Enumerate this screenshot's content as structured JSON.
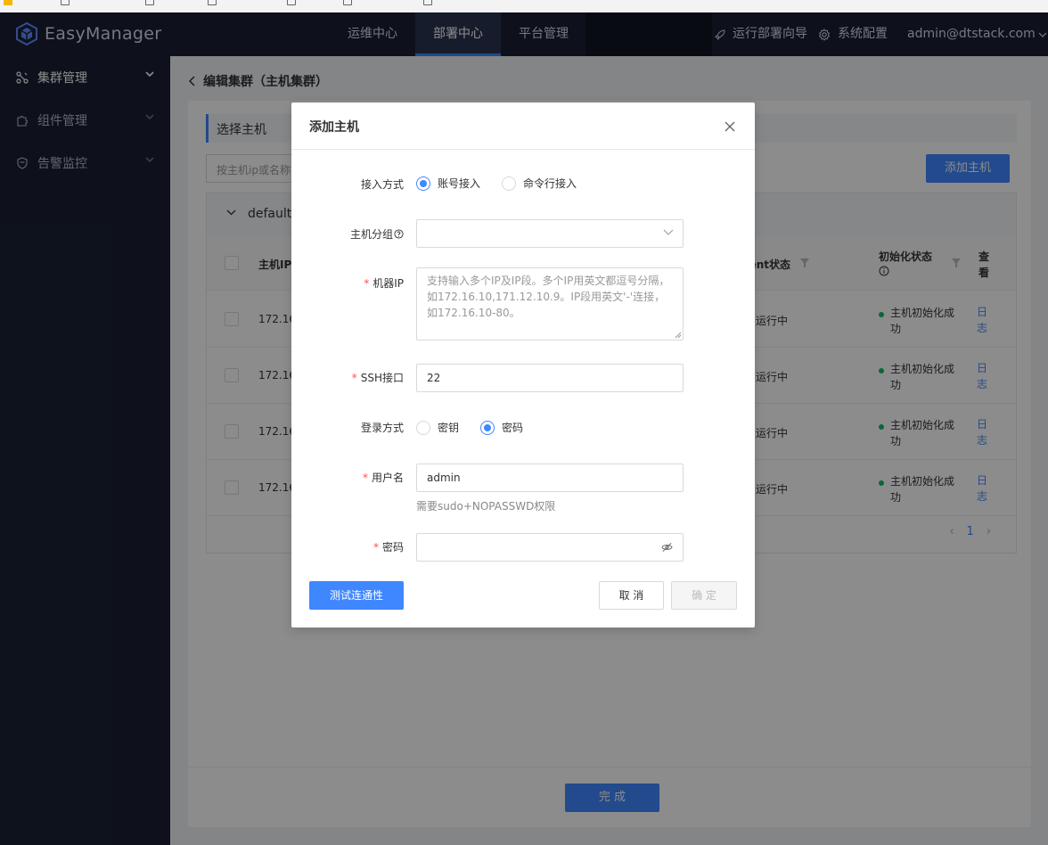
{
  "app": {
    "name": "EasyManager"
  },
  "header": {
    "nav": [
      {
        "label": "运维中心"
      },
      {
        "label": "部署中心"
      },
      {
        "label": "平台管理"
      }
    ],
    "guide_label": "运行部署向导",
    "config_label": "系统配置",
    "user": "admin@dtstack.com"
  },
  "sidebar": {
    "items": [
      {
        "label": "集群管理"
      },
      {
        "label": "组件管理"
      },
      {
        "label": "告警监控"
      }
    ]
  },
  "page": {
    "title": "编辑集群（主机集群）",
    "section_title": "选择主机",
    "search_placeholder": "按主机ip或名称搜",
    "add_host_label": "添加主机",
    "group_name": "default",
    "columns": {
      "ip": "主机IP",
      "agent": "gent状态",
      "init": "初始化状态",
      "view": "查看"
    },
    "rows": [
      {
        "ip": "172.16",
        "agent": "运行中",
        "init": "主机初始化成功",
        "log": "日志"
      },
      {
        "ip": "172.16",
        "agent": "运行中",
        "init": "主机初始化成功",
        "log": "日志"
      },
      {
        "ip": "172.16",
        "agent": "运行中",
        "init": "主机初始化成功",
        "log": "日志"
      },
      {
        "ip": "172.16",
        "agent": "运行中",
        "init": "主机初始化成功",
        "log": "日志"
      }
    ],
    "pagination": {
      "current": "1"
    },
    "done_label": "完 成"
  },
  "modal": {
    "title": "添加主机",
    "access": {
      "label": "接入方式",
      "options": [
        "账号接入",
        "命令行接入"
      ],
      "selected": "账号接入"
    },
    "group": {
      "label": "主机分组",
      "value": ""
    },
    "ip": {
      "label": "机器IP",
      "placeholder": "支持输入多个IP及IP段。多个IP用英文都逗号分隔，如172.16.10,171.12.10.9。IP段用英文'-'连接，如172.16.10-80。"
    },
    "ssh": {
      "label": "SSH接口",
      "value": "22"
    },
    "login": {
      "label": "登录方式",
      "options": [
        "密钥",
        "密码"
      ],
      "selected": "密码"
    },
    "username": {
      "label": "用户名",
      "value": "admin",
      "hint": "需要sudo+NOPASSWD权限"
    },
    "password": {
      "label": "密码",
      "value": ""
    },
    "buttons": {
      "test": "测试连通性",
      "cancel": "取 消",
      "ok": "确 定"
    }
  },
  "colors": {
    "accent": "#3f87ff",
    "header_bg": "#1a2033",
    "success": "#12bc6a",
    "required": "#ff4d4f"
  }
}
